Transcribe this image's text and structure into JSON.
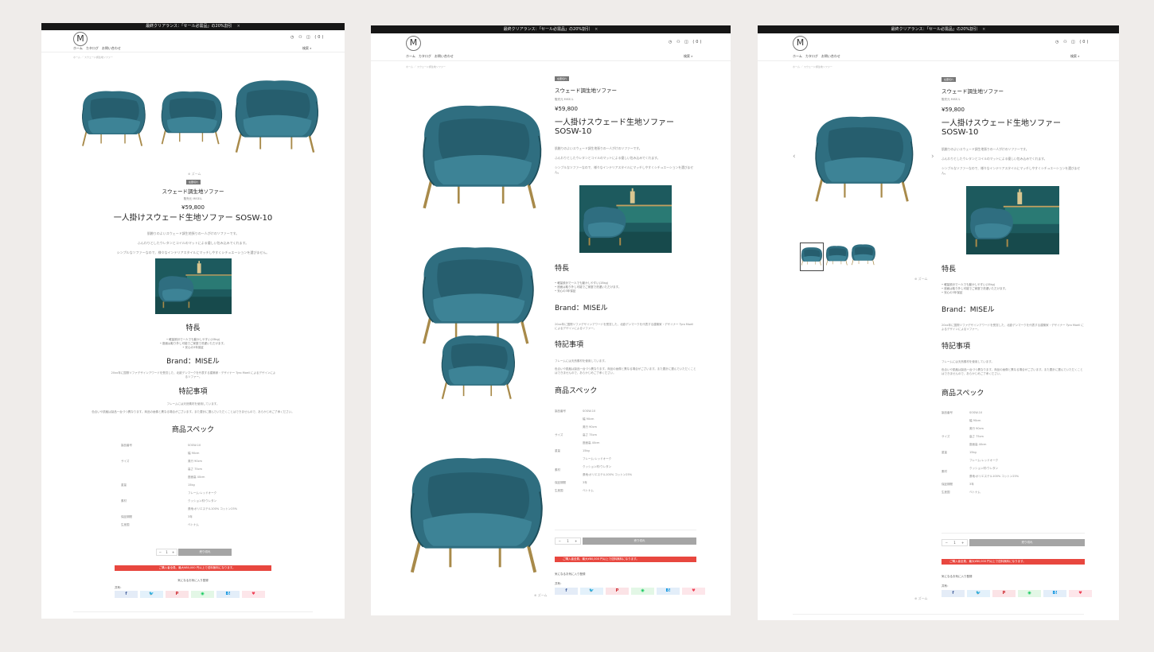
{
  "colors": {
    "background": "#efecea",
    "announcement_bar": "#161616",
    "chair": "#2f6e80",
    "red_bar": "#e8473f",
    "cart_button": "#a5a5a5"
  },
  "announcement": {
    "text": "最終クリアランス：「セール必需品」の20%割引",
    "close": "×"
  },
  "header": {
    "logo": "M",
    "icons": [
      "help-icon",
      "account-icon",
      "cart-icon"
    ],
    "icons_text": "◷ ⚇ ◫ (0)",
    "nav": [
      "ホーム",
      "カタログ",
      "お問い合わせ"
    ],
    "search_label": "検索",
    "search_icon": "⌕"
  },
  "breadcrumb": "ホーム ／ スウェード調生地ソファー",
  "product": {
    "badge": "在庫切れ",
    "name": "スウェード調生地ソファー",
    "vendor_label": "販売元",
    "vendor": "MISEル",
    "price": "¥59,800",
    "title": "一人掛けスウェード生地ソファー SOSW-10",
    "title_line1": "一人掛けスウェード生地ソファー",
    "title_line2": "SOSW-10",
    "desc": [
      "肌触りのよいスウェード調生地張りの一人がけのソファーです。",
      "ふんわりとしたウレタンとコイルのマットによる優しい包み込みでくれます。",
      "シンプルなソファーなので、様々なインテリアスタイルにマッチしやすくシチュエーションを選びません。"
    ]
  },
  "features": {
    "heading": "特長",
    "items": [
      "軽量設計で一人でも動かしやすい(15kg)",
      "座面は取り外し可能でご家庭で洗濯いただけます。",
      "安心の3年保証"
    ]
  },
  "brand": {
    "heading": "Brand：MISEル",
    "text": "20xx年に国際ソファデザインアワードを受賞した、北欧デンマークを代表する建築家・デザイナー Tyro Moell によるデザインによるソファー。"
  },
  "notes": {
    "heading": "特記事項",
    "items": [
      "フレームには天然素材を使用しています。",
      "色合いや肌触は製品一台づつ異なります。商品の画像と異なる場合がございます。また要計に選んでいただくことはできませんので、あらかじめご了承ください。"
    ]
  },
  "specs": {
    "heading": "商品スペック",
    "rows": [
      {
        "label": "製品番号",
        "values": [
          "SOSW-10"
        ]
      },
      {
        "label": "サイズ",
        "values": [
          "幅 90cm",
          "奥行 90cm",
          "高さ 75cm",
          "座面高 40cm"
        ]
      },
      {
        "label": "重量",
        "values": [
          "15kg"
        ]
      },
      {
        "label": "素材",
        "values": [
          "フレーム:レッドオーク",
          "クッション材:ウレタン",
          "張地:ポリエステル100% コットン25%"
        ]
      },
      {
        "label": "保証期間",
        "values": [
          "3年"
        ]
      },
      {
        "label": "生産国",
        "values": [
          "ベトナム"
        ]
      }
    ]
  },
  "purchase": {
    "minus": "−",
    "qty": "1",
    "plus": "+",
    "cart_button": "売り切れ",
    "red_bar": "ご購入者全員、最大¥80,000 円以上で送料無料になります。",
    "recommend_heading": "気になるお気に入り登録",
    "share_label": "共有：",
    "share": [
      {
        "icon": "facebook-icon",
        "glyph": "f"
      },
      {
        "icon": "twitter-icon",
        "glyph": "🐦"
      },
      {
        "icon": "pinterest-icon",
        "glyph": "P"
      },
      {
        "icon": "line-icon",
        "glyph": "◉"
      },
      {
        "icon": "hatena-icon",
        "glyph": "B!"
      },
      {
        "icon": "pocket-icon",
        "glyph": "♥"
      }
    ]
  },
  "gallery": {
    "zoom_label": "ズーム",
    "prev": "‹",
    "next": "›"
  }
}
